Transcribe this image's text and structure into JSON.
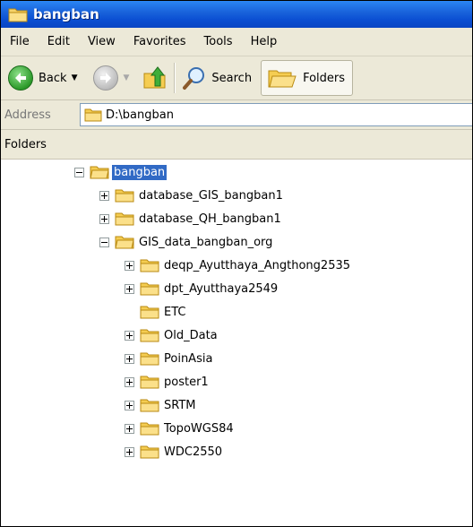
{
  "window": {
    "title": "bangban"
  },
  "menu": {
    "items": [
      "File",
      "Edit",
      "View",
      "Favorites",
      "Tools",
      "Help"
    ]
  },
  "toolbar": {
    "back_label": "Back",
    "search_label": "Search",
    "folders_label": "Folders"
  },
  "address": {
    "label": "Address",
    "value": "D:\\bangban"
  },
  "pane": {
    "title": "Folders"
  },
  "tree": {
    "nodes": [
      {
        "label": "bangban",
        "level": 0,
        "expander": "minus",
        "selected": true
      },
      {
        "label": "database_GIS_bangban1",
        "level": 1,
        "expander": "plus"
      },
      {
        "label": "database_QH_bangban1",
        "level": 1,
        "expander": "plus"
      },
      {
        "label": "GIS_data_bangban_org",
        "level": 1,
        "expander": "minus"
      },
      {
        "label": "deqp_Ayutthaya_Angthong2535",
        "level": 2,
        "expander": "plus"
      },
      {
        "label": "dpt_Ayutthaya2549",
        "level": 2,
        "expander": "plus"
      },
      {
        "label": "ETC",
        "level": 2,
        "expander": "none"
      },
      {
        "label": "Old_Data",
        "level": 2,
        "expander": "plus"
      },
      {
        "label": "PoinAsia",
        "level": 2,
        "expander": "plus"
      },
      {
        "label": "poster1",
        "level": 2,
        "expander": "plus"
      },
      {
        "label": "SRTM",
        "level": 2,
        "expander": "plus"
      },
      {
        "label": "TopoWGS84",
        "level": 2,
        "expander": "plus"
      },
      {
        "label": "WDC2550",
        "level": 2,
        "expander": "plus"
      }
    ]
  },
  "colors": {
    "titlebar": "#0b4fd2",
    "chrome": "#ece9d8",
    "selection": "#316ac5",
    "folder": "#f5cd52"
  }
}
